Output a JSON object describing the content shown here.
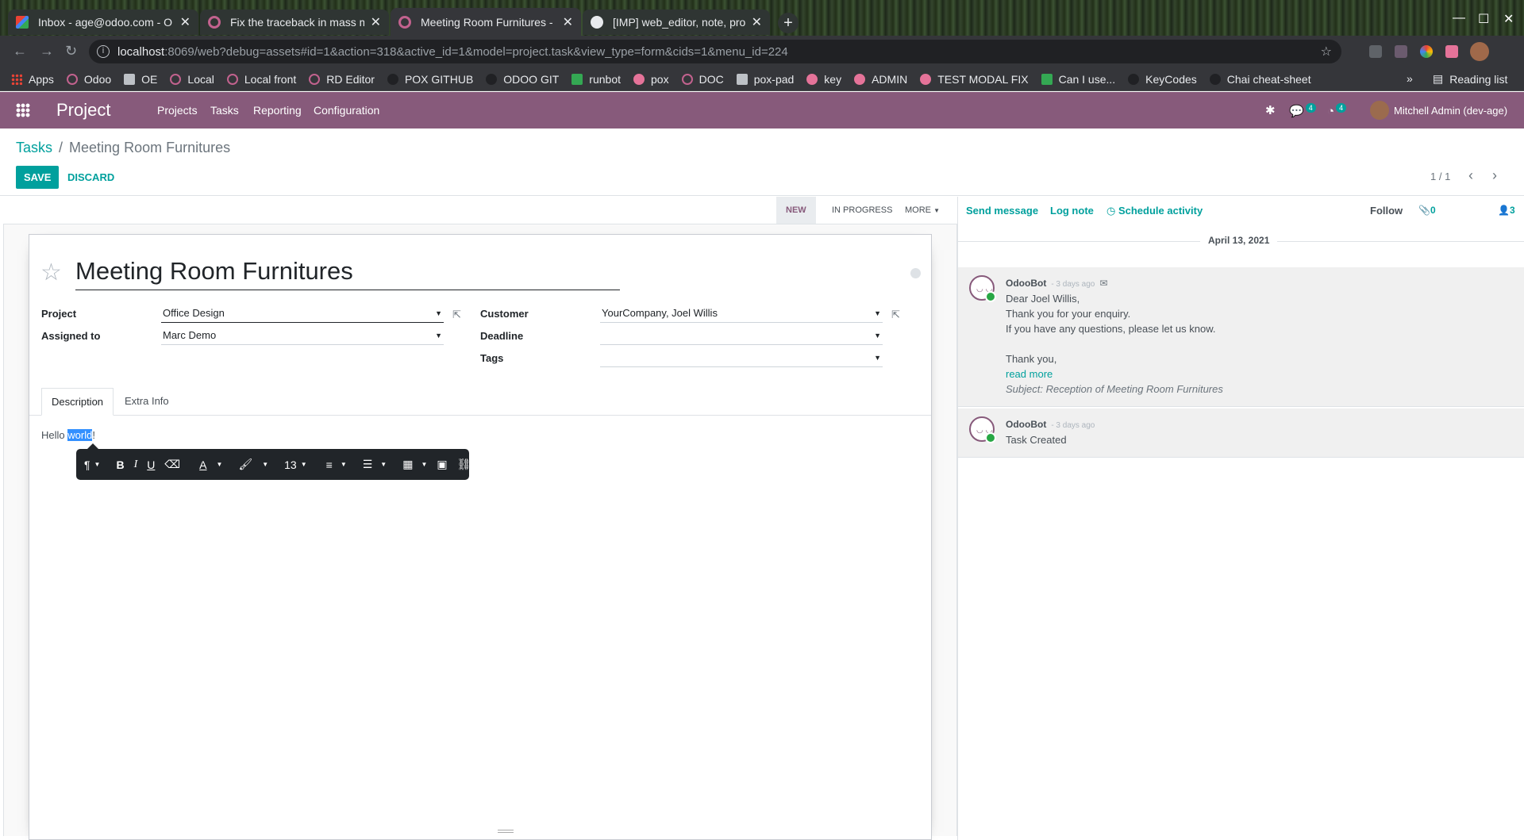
{
  "browser": {
    "tabs": [
      {
        "title": "Inbox - age@odoo.com - O",
        "icon": "gmail-icon"
      },
      {
        "title": "Fix the traceback in mass m",
        "icon": "odoo-icon"
      },
      {
        "title": "Meeting Room Furnitures -",
        "icon": "odoo-icon",
        "active": true
      },
      {
        "title": "[IMP] web_editor, note, pro",
        "icon": "github-icon"
      }
    ],
    "url_host": "localhost",
    "url_rest": ":8069/web?debug=assets#id=1&action=318&active_id=1&model=project.task&view_type=form&cids=1&menu_id=224",
    "bookmarks": [
      "Apps",
      "Odoo",
      "OE",
      "Local",
      "Local front",
      "RD Editor",
      "POX GITHUB",
      "ODOO GIT",
      "runbot",
      "pox",
      "DOC",
      "pox-pad",
      "key",
      "ADMIN",
      "TEST MODAL FIX",
      "Can I use...",
      "KeyCodes",
      "Chai cheat-sheet"
    ],
    "more": "»",
    "reading_list": "Reading list"
  },
  "navbar": {
    "brand": "Project",
    "menus": [
      "Projects",
      "Tasks",
      "Reporting",
      "Configuration"
    ],
    "messages_count": "4",
    "activities_count": "4",
    "user": "Mitchell Admin (dev-age)"
  },
  "control_panel": {
    "breadcrumb_parent": "Tasks",
    "breadcrumb_sep": "/",
    "breadcrumb_current": "Meeting Room Furnitures",
    "save": "SAVE",
    "discard": "DISCARD",
    "pager": "1 / 1"
  },
  "statusbar": {
    "stages": [
      "NEW",
      "IN PROGRESS"
    ],
    "active_stage": "NEW",
    "more": "MORE"
  },
  "form": {
    "title": "Meeting Room Furnitures",
    "fields": {
      "project_label": "Project",
      "project_value": "Office Design",
      "assigned_label": "Assigned to",
      "assigned_value": "Marc Demo",
      "customer_label": "Customer",
      "customer_value": "YourCompany, Joel Willis",
      "deadline_label": "Deadline",
      "deadline_value": "",
      "tags_label": "Tags",
      "tags_value": ""
    },
    "tabs": [
      "Description",
      "Extra Info"
    ],
    "description_before": "Hello ",
    "description_selected": "world",
    "description_after": "!"
  },
  "editor_toolbar": {
    "font_size": "13"
  },
  "chatter": {
    "send_message": "Send message",
    "log_note": "Log note",
    "schedule_activity": "Schedule activity",
    "attachments_count": "0",
    "follow": "Follow",
    "followers_count": "3",
    "date": "April 13, 2021",
    "messages": [
      {
        "author": "OdooBot",
        "when": "- 3 days ago",
        "lines": [
          "Dear Joel Willis,",
          "Thank you for your enquiry.",
          "If you have any questions, please let us know.",
          "",
          "Thank you,"
        ],
        "read_more": "read more",
        "subject": "Subject: Reception of Meeting Room Furnitures"
      },
      {
        "author": "OdooBot",
        "when": "- 3 days ago",
        "lines": [
          "Task Created"
        ]
      }
    ]
  },
  "colors": {
    "brand": "#875a7b",
    "accent": "#00a09d"
  }
}
